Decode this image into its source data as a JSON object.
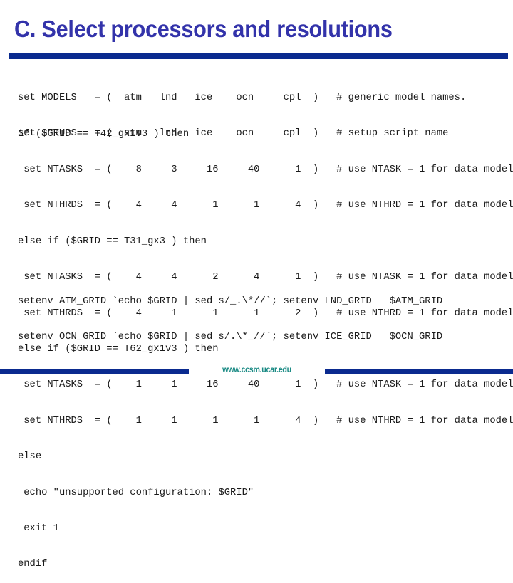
{
  "slide": {
    "title": "C. Select processors and resolutions",
    "footer_url": "www.ccsm.ucar.edu",
    "colors": {
      "title": "#3333aa",
      "rule": "#0a2a8f",
      "footer_url": "#1a8a84"
    }
  },
  "code": {
    "block1": [
      "set MODELS   = (  atm   lnd   ice    ocn     cpl  )   # generic model names.",
      "set SETUPS   = (  atm   lnd   ice    ocn     cpl  )   # setup script name"
    ],
    "block2": [
      "if ($GRID == T42_gx1v3 ) then",
      " set NTASKS  = (    8     3     16     40      1  )   # use NTASK = 1 for data model",
      " set NTHRDS  = (    4     4      1      1      4  )   # use NTHRD = 1 for data model",
      "else if ($GRID == T31_gx3 ) then",
      " set NTASKS  = (    4     4      2      4      1  )   # use NTASK = 1 for data model",
      " set NTHRDS  = (    4     1      1      1      2  )   # use NTHRD = 1 for data model",
      "else if ($GRID == T62_gx1v3 ) then",
      " set NTASKS  = (    1     1     16     40      1  )   # use NTASK = 1 for data model",
      " set NTHRDS  = (    1     1      1      1      4  )   # use NTHRD = 1 for data model",
      "else",
      " echo \"unsupported configuration: $GRID\"",
      " exit 1",
      "endif"
    ],
    "block3": [
      "setenv ATM_GRID `echo $GRID | sed s/_.\\*//`; setenv LND_GRID   $ATM_GRID",
      "setenv OCN_GRID `echo $GRID | sed s/.\\*_//`; setenv ICE_GRID   $OCN_GRID"
    ]
  }
}
